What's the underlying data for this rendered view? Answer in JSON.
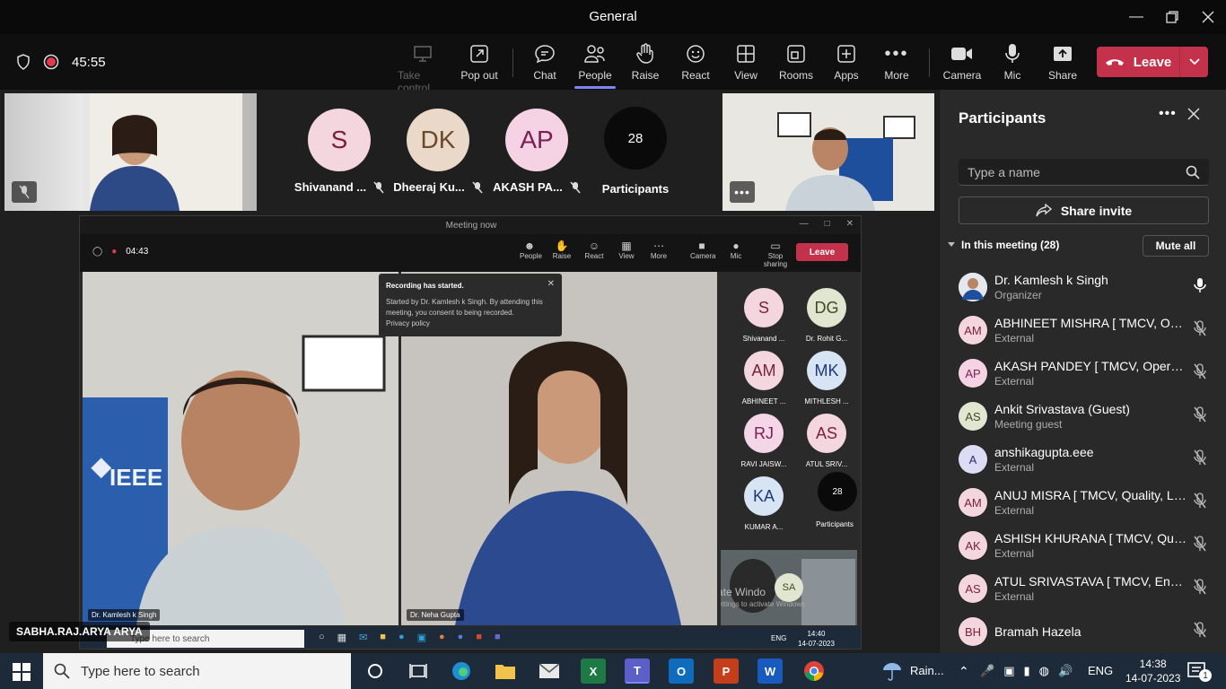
{
  "window": {
    "title": "General"
  },
  "meeting": {
    "timer": "45:55"
  },
  "toolbar": {
    "take_control": "Take control",
    "pop_out": "Pop out",
    "chat": "Chat",
    "people": "People",
    "raise": "Raise",
    "react": "React",
    "view": "View",
    "rooms": "Rooms",
    "apps": "Apps",
    "more": "More",
    "camera": "Camera",
    "mic": "Mic",
    "share": "Share",
    "leave": "Leave"
  },
  "stage": {
    "tiles": [
      {
        "initials": "S",
        "name": "Shivanand ...",
        "color": "#f4d6de",
        "text_color": "#7a1f3a"
      },
      {
        "initials": "DK",
        "name": "Dheeraj Ku...",
        "color": "#ead9c8",
        "text_color": "#6b4a2b"
      },
      {
        "initials": "AP",
        "name": "AKASH PA...",
        "color": "#f5d3e4",
        "text_color": "#7a1f52"
      }
    ],
    "participants_count": "28",
    "participants_label": "Participants"
  },
  "shared": {
    "title": "Meeting now",
    "timer": "04:43",
    "toolbar": {
      "people": "People",
      "raise": "Raise",
      "react": "React",
      "view": "View",
      "more": "More",
      "camera": "Camera",
      "mic": "Mic",
      "stop_sharing": "Stop sharing",
      "leave": "Leave"
    },
    "toast": {
      "title": "Recording has started.",
      "body": "Started by Dr. Kamlesh k Singh. By attending this meeting, you consent to being recorded.",
      "link": "Privacy policy"
    },
    "video_labels": {
      "left": "Dr. Kamlesh k Singh",
      "right": "Dr. Neha Gupta"
    },
    "ieee": "IEEE",
    "mini_tiles": [
      {
        "initials": "S",
        "name": "Shivanand ...",
        "color": "#f4d6de",
        "text_color": "#7a1f3a"
      },
      {
        "initials": "DG",
        "name": "Dr. Rohit G...",
        "color": "#e0e6d0",
        "text_color": "#3d4a22"
      },
      {
        "initials": "AM",
        "name": "ABHINEET ...",
        "color": "#f4d6de",
        "text_color": "#7a1f3a"
      },
      {
        "initials": "MK",
        "name": "MITHLESH ...",
        "color": "#d6e4f4",
        "text_color": "#1f3a7a"
      },
      {
        "initials": "RJ",
        "name": "RAVI JAISW...",
        "color": "#f4d6e8",
        "text_color": "#7a1f52"
      },
      {
        "initials": "AS",
        "name": "ATUL SRIV...",
        "color": "#f4d6de",
        "text_color": "#7a1f3a"
      },
      {
        "initials": "KA",
        "name": "KUMAR A...",
        "color": "#d6e4f4",
        "text_color": "#1f3a7a"
      }
    ],
    "mini_participants_count": "28",
    "mini_participants_label": "Participants",
    "sa_initials": "SA",
    "activate": "Activate Windo",
    "activate_sub": "Go to Settings to activate Windows",
    "inner_taskbar": {
      "search": "Type here to search",
      "lang": "ENG",
      "time": "14:40",
      "date": "14-07-2023"
    }
  },
  "speaker_label": "SABHA.RAJ.ARYA ARYA",
  "panel": {
    "title": "Participants",
    "search_placeholder": "Type a name",
    "share_invite": "Share invite",
    "in_meeting": "In this meeting (28)",
    "mute_all": "Mute all",
    "participants": [
      {
        "initials": "",
        "name": "Dr. Kamlesh k Singh",
        "role": "Organizer",
        "color": "#cfd8e3",
        "text_color": "#1f3a5a",
        "mic": "on",
        "photo": true
      },
      {
        "initials": "AM",
        "name": "ABHINEET MISHRA [ TMCV, Ope...",
        "role": "External",
        "color": "#f4d6de",
        "text_color": "#7a1f3a",
        "mic": "off"
      },
      {
        "initials": "AP",
        "name": "AKASH PANDEY [ TMCV, Operati...",
        "role": "External",
        "color": "#f5d3e4",
        "text_color": "#7a1f52",
        "mic": "off"
      },
      {
        "initials": "AS",
        "name": "Ankit Srivastava (Guest)",
        "role": "Meeting guest",
        "color": "#e0e6d0",
        "text_color": "#3d4a22",
        "mic": "off"
      },
      {
        "initials": "A",
        "name": "anshikagupta.eee",
        "role": "External",
        "color": "#dcdcf4",
        "text_color": "#2a2a7a",
        "mic": "off"
      },
      {
        "initials": "AM",
        "name": "ANUJ MISRA [ TMCV, Quality, Lu...",
        "role": "External",
        "color": "#f4d6de",
        "text_color": "#7a1f3a",
        "mic": "off"
      },
      {
        "initials": "AK",
        "name": "ASHISH KHURANA [ TMCV, Qual...",
        "role": "External",
        "color": "#f4d6de",
        "text_color": "#7a1f3a",
        "mic": "off"
      },
      {
        "initials": "AS",
        "name": "ATUL SRIVASTAVA [ TMCV, Engin...",
        "role": "External",
        "color": "#f4d6de",
        "text_color": "#7a1f3a",
        "mic": "off"
      },
      {
        "initials": "BH",
        "name": "Bramah Hazela",
        "role": "",
        "color": "#f4d6de",
        "text_color": "#7a1f3a",
        "mic": "off"
      }
    ]
  },
  "taskbar": {
    "search": "Type here to search",
    "weather": "Rain...",
    "lang": "ENG",
    "time": "14:38",
    "date": "14-07-2023",
    "notifications": "1"
  }
}
